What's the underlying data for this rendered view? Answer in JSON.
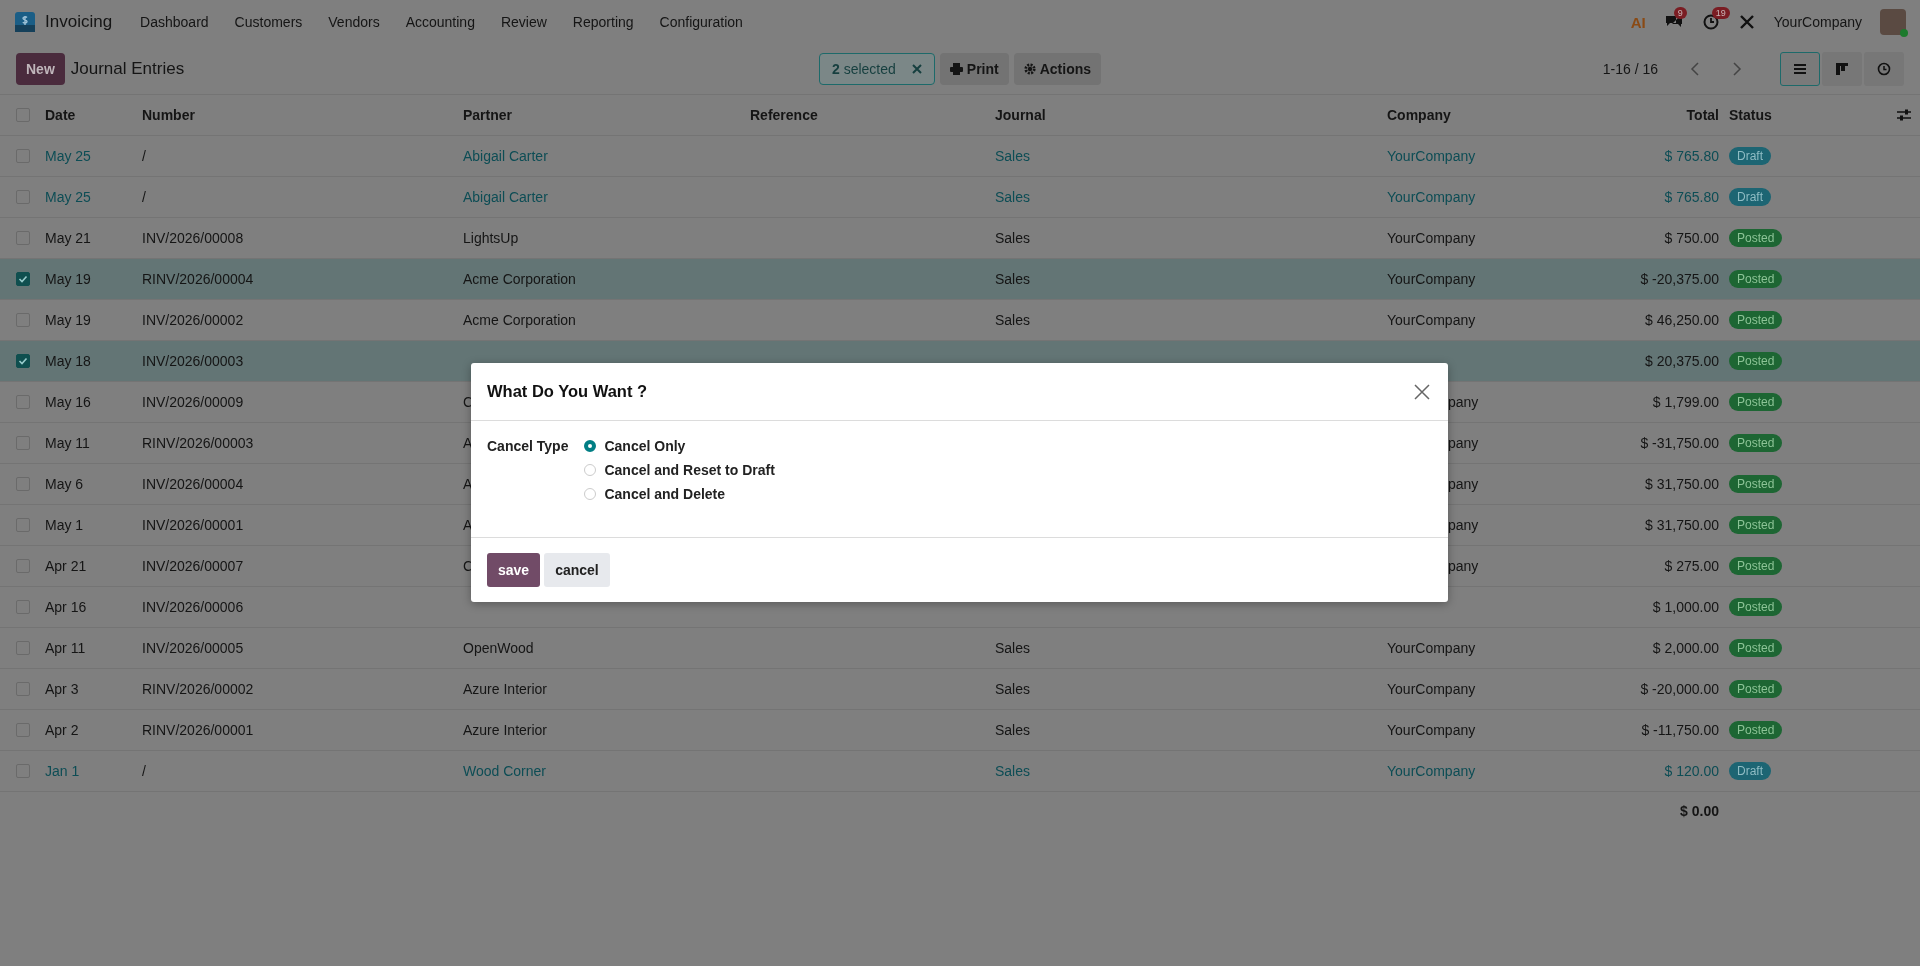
{
  "navbar": {
    "app_name": "Invoicing",
    "menu": [
      "Dashboard",
      "Customers",
      "Vendors",
      "Accounting",
      "Review",
      "Reporting",
      "Configuration"
    ],
    "ai_label": "AI",
    "messages_count": "9",
    "activities_count": "19",
    "company": "YourCompany"
  },
  "control_panel": {
    "new_button": "New",
    "title": "Journal Entries",
    "selection": "**2** selected",
    "print": "Print",
    "actions": "Actions",
    "pager": "1-16 / 16",
    "views": [
      {
        "kind": "list",
        "selected": true
      },
      {
        "kind": "kanban",
        "selected": false
      },
      {
        "kind": "activity",
        "selected": false
      }
    ]
  },
  "table": {
    "select_all_checked": false,
    "columns": [
      "Date",
      "Number",
      "Partner",
      "Reference",
      "Journal",
      "Company",
      "Total",
      "Status"
    ],
    "rows": [
      {
        "selected": false,
        "date": "May 25",
        "number": "/",
        "partner": "Abigail Carter",
        "journal": "Sales",
        "company": "YourCompany",
        "total": "$ 765.80",
        "status": {
          "label": "Draft",
          "color": "#1d6573"
        }
      },
      {
        "selected": false,
        "date": "May 25",
        "number": "/",
        "partner": "Abigail Carter",
        "journal": "Sales",
        "company": "YourCompany",
        "total": "$ 765.80",
        "status": {
          "label": "Draft",
          "color": "#1d6573"
        }
      },
      {
        "selected": false,
        "date": "May 21",
        "number": "INV/2026/00008",
        "partner": "LightsUp",
        "journal": "Sales",
        "company": "YourCompany",
        "total": "$ 750.00",
        "status": {
          "label": "Posted",
          "color": "#1d6633"
        }
      },
      {
        "selected": true,
        "date": "May 19",
        "number": "RINV/2026/00004",
        "partner": "Acme Corporation",
        "journal": "Sales",
        "company": "YourCompany",
        "total": "$ -20,375.00",
        "status": {
          "label": "Posted",
          "color": "#1d6633"
        }
      },
      {
        "selected": false,
        "date": "May 19",
        "number": "INV/2026/00002",
        "partner": "Acme Corporation",
        "journal": "Sales",
        "company": "YourCompany",
        "total": "$ 46,250.00",
        "status": {
          "label": "Posted",
          "color": "#1d6633"
        }
      },
      {
        "selected": true,
        "date": "May 18",
        "number": "INV/2026/00003",
        "total": "$ 20,375.00",
        "status": {
          "label": "Posted",
          "color": "#1d6633"
        }
      },
      {
        "selected": false,
        "date": "May 16",
        "number": "INV/2026/00009",
        "partner": "C",
        "company": "pany",
        "total": "$ 1,799.00",
        "status": {
          "label": "Posted",
          "color": "#1d6633"
        }
      },
      {
        "selected": false,
        "date": "May 11",
        "number": "RINV/2026/00003",
        "partner": "A",
        "company": "pany",
        "total": "$ -31,750.00",
        "status": {
          "label": "Posted",
          "color": "#1d6633"
        }
      },
      {
        "selected": false,
        "date": "May 6",
        "number": "INV/2026/00004",
        "partner": "A",
        "company": "pany",
        "total": "$ 31,750.00",
        "status": {
          "label": "Posted",
          "color": "#1d6633"
        }
      },
      {
        "selected": false,
        "date": "May 1",
        "number": "INV/2026/00001",
        "partner": "A",
        "company": "pany",
        "total": "$ 31,750.00",
        "status": {
          "label": "Posted",
          "color": "#1d6633"
        }
      },
      {
        "selected": false,
        "date": "Apr 21",
        "number": "INV/2026/00007",
        "partner": "C",
        "company": "pany",
        "total": "$ 275.00",
        "status": {
          "label": "Posted",
          "color": "#1d6633"
        }
      },
      {
        "selected": false,
        "date": "Apr 16",
        "number": "INV/2026/00006",
        "total": "$ 1,000.00",
        "status": {
          "label": "Posted",
          "color": "#1d6633"
        }
      },
      {
        "selected": false,
        "date": "Apr 11",
        "number": "INV/2026/00005",
        "partner": "OpenWood",
        "journal": "Sales",
        "company": "YourCompany",
        "total": "$ 2,000.00",
        "status": {
          "label": "Posted",
          "color": "#1d6633"
        }
      },
      {
        "selected": false,
        "date": "Apr 3",
        "number": "RINV/2026/00002",
        "partner": "Azure Interior",
        "journal": "Sales",
        "company": "YourCompany",
        "total": "$ -20,000.00",
        "status": {
          "label": "Posted",
          "color": "#1d6633"
        }
      },
      {
        "selected": false,
        "date": "Apr 2",
        "number": "RINV/2026/00001",
        "partner": "Azure Interior",
        "journal": "Sales",
        "company": "YourCompany",
        "total": "$ -11,750.00",
        "status": {
          "label": "Posted",
          "color": "#1d6633"
        }
      },
      {
        "selected": false,
        "date": "Jan 1",
        "number": "/",
        "partner": "Wood Corner",
        "journal": "Sales",
        "company": "YourCompany",
        "total": "$ 120.00",
        "status": {
          "label": "Draft",
          "color": "#1d6573"
        }
      }
    ],
    "footer_total": "$ 0.00"
  },
  "dialog": {
    "title": "What Do You Want ?",
    "field_label": "Cancel Type",
    "options": [
      {
        "label": "Cancel Only",
        "selected": true
      },
      {
        "label": "Cancel and Reset to Draft",
        "selected": false
      },
      {
        "label": "Cancel and Delete",
        "selected": false
      }
    ],
    "buttons": [
      "save",
      "cancel"
    ]
  }
}
